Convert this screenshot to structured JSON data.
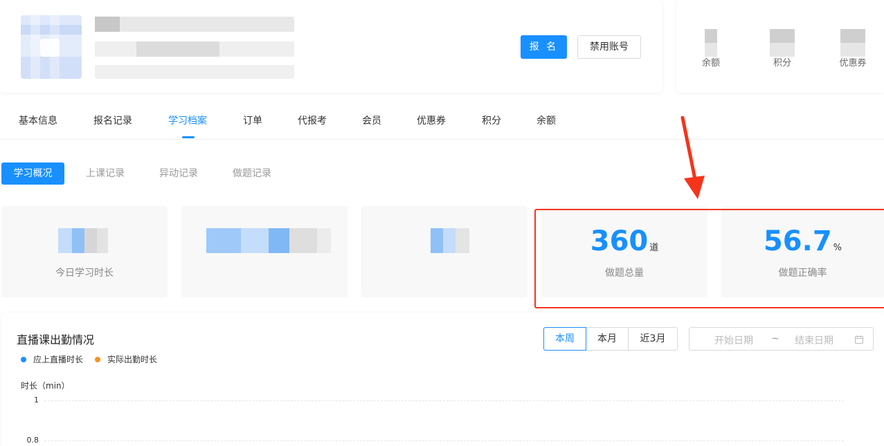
{
  "profile": {
    "signup_label": "报 名",
    "disable_label": "禁用账号"
  },
  "assets": [
    {
      "label": "余额"
    },
    {
      "label": "积分"
    },
    {
      "label": "优惠券"
    }
  ],
  "main_tabs": [
    "基本信息",
    "报名记录",
    "学习档案",
    "订单",
    "代报考",
    "会员",
    "优惠券",
    "积分",
    "余额"
  ],
  "active_main_tab": "学习档案",
  "sub_tabs": [
    "学习概况",
    "上课记录",
    "异动记录",
    "做题记录"
  ],
  "active_sub_tab": "学习概况",
  "stats": [
    {
      "label": "今日学习时长"
    },
    {
      "label": ""
    },
    {
      "label": ""
    },
    {
      "value": "360",
      "unit": "道",
      "label": "做题总量"
    },
    {
      "value": "56.7",
      "unit": "%",
      "label": "做题正确率"
    }
  ],
  "colors": {
    "primary": "#1890ff",
    "highlight": "#f5341c",
    "legend_planned": "#1890ff",
    "legend_actual": "#f7931e"
  },
  "chart_panel": {
    "title": "直播课出勤情况",
    "legend": [
      "应上直播时长",
      "实际出勤时长"
    ],
    "ranges": [
      "本周",
      "本月",
      "近3月"
    ],
    "active_range": "本周",
    "date_start_placeholder": "开始日期",
    "date_separator": "~",
    "date_end_placeholder": "结束日期",
    "calendar_icon": "calendar-icon"
  },
  "chart_data": {
    "type": "line",
    "ylabel": "时长（min）",
    "yticks": [
      "1",
      "0.8"
    ],
    "series": [
      {
        "name": "应上直播时长",
        "values": []
      },
      {
        "name": "实际出勤时长",
        "values": []
      }
    ]
  }
}
